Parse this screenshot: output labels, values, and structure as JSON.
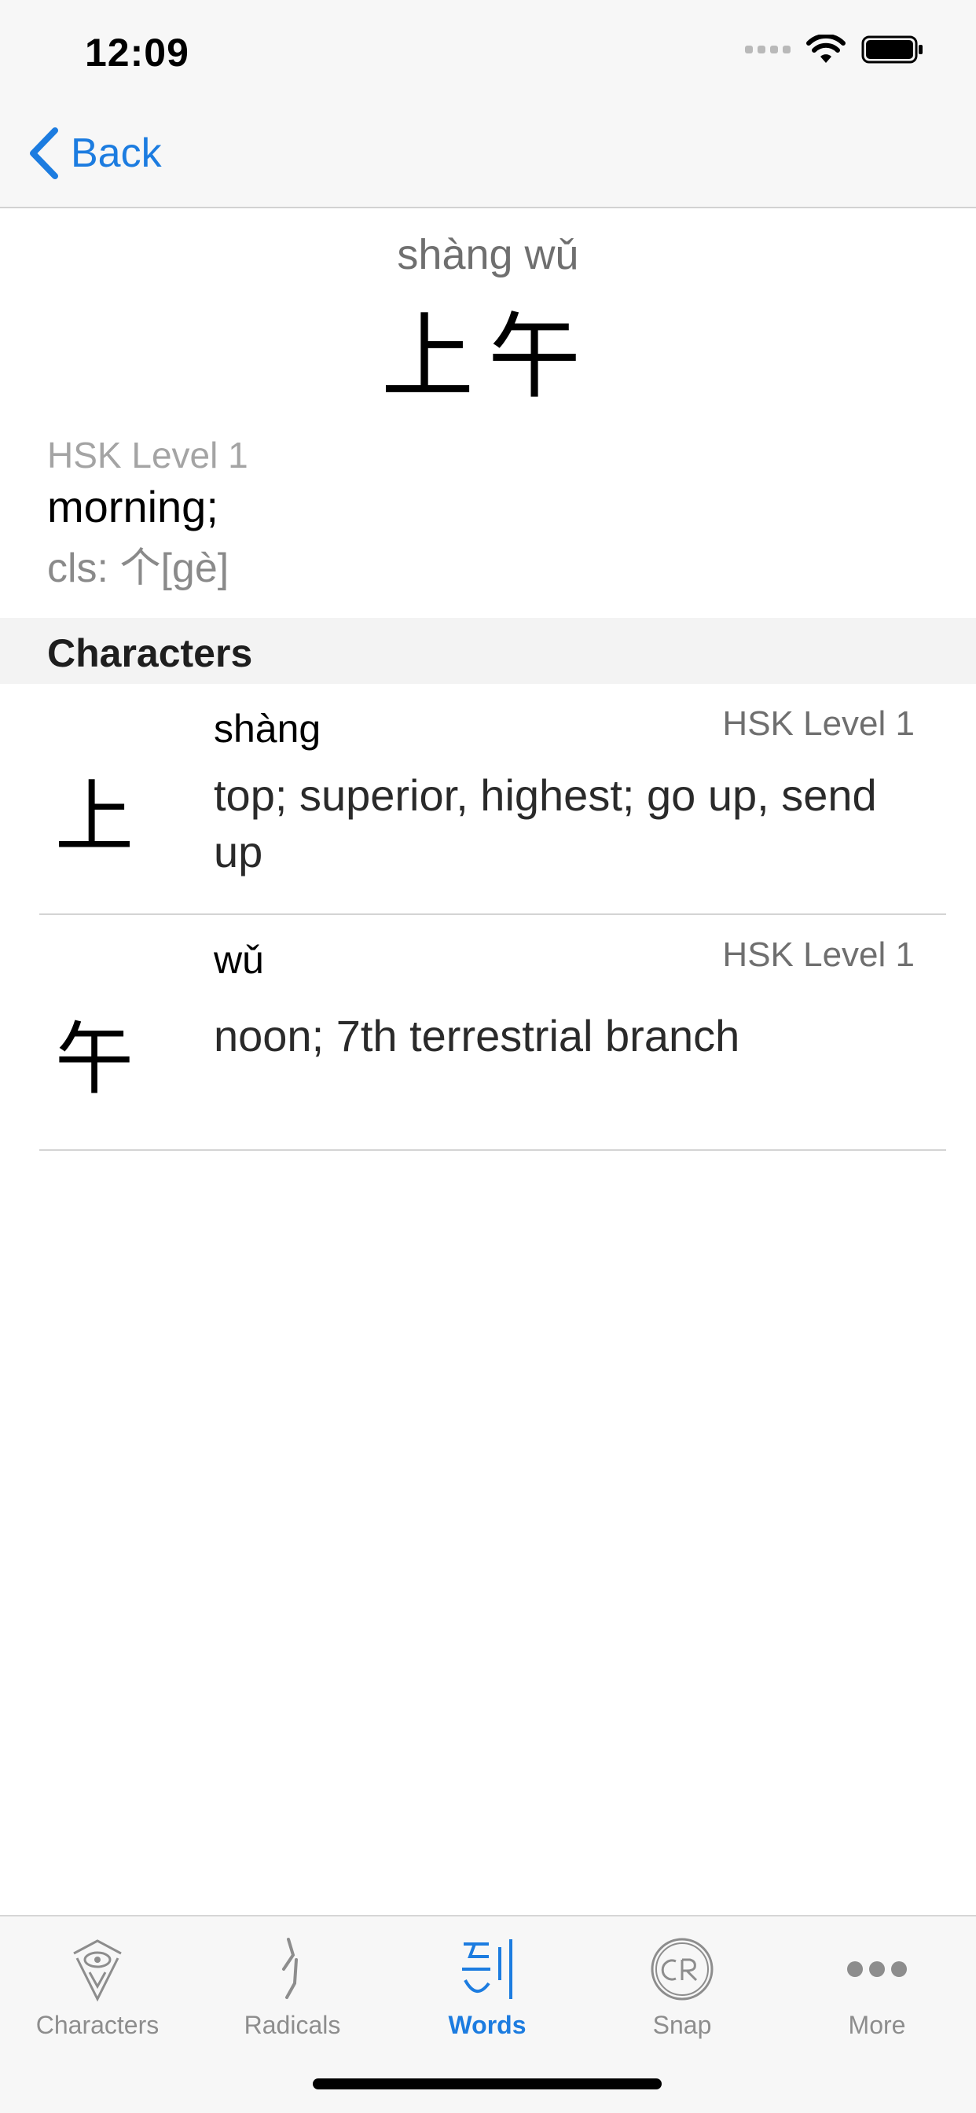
{
  "status_bar": {
    "time": "12:09"
  },
  "nav": {
    "back_label": "Back"
  },
  "word": {
    "pinyin": "shàng wǔ",
    "hanzi": "上午",
    "hsk_level": "HSK Level 1",
    "definition": "morning;",
    "classifier": "cls: 个[gè]"
  },
  "section": {
    "title": "Characters"
  },
  "characters": [
    {
      "hanzi": "上",
      "pinyin": "shàng",
      "hsk_level": "HSK Level 1",
      "definition": "top; superior, highest; go up, send up"
    },
    {
      "hanzi": "午",
      "pinyin": "wǔ",
      "hsk_level": "HSK Level 1",
      "definition": "noon; 7th terrestrial branch"
    }
  ],
  "tabs": [
    {
      "label": "Characters",
      "icon": "characters-icon",
      "active": false
    },
    {
      "label": "Radicals",
      "icon": "radicals-icon",
      "active": false
    },
    {
      "label": "Words",
      "icon": "words-icon",
      "active": true
    },
    {
      "label": "Snap",
      "icon": "snap-icon",
      "active": false
    },
    {
      "label": "More",
      "icon": "more-icon",
      "active": false
    }
  ],
  "colors": {
    "accent": "#1c7ce0",
    "tab_inactive": "#8d8d8d",
    "section_bg": "#f3f3f3"
  }
}
